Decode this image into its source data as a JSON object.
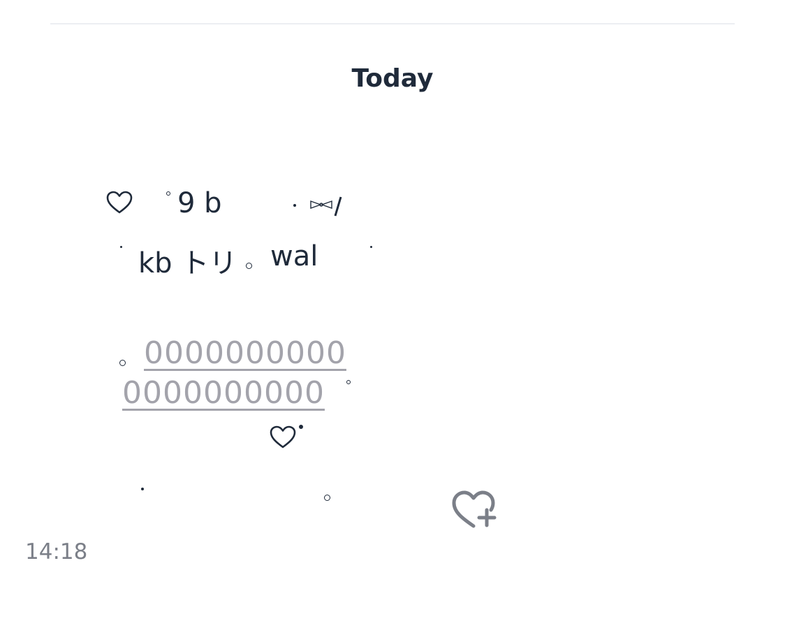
{
  "date_separator": "Today",
  "message": {
    "line1": {
      "text": "9 b",
      "heart_icon": "heart-outline-icon",
      "bow_icon": "bow-ribbon-icon"
    },
    "line2": {
      "part1": "kb トリ",
      "part2": "wal"
    },
    "link_line1": "0000000000",
    "link_line2": "0000000000",
    "heart_icon": "heart-outline-icon"
  },
  "reaction_button": {
    "icon": "heart-plus-icon"
  },
  "timestamp": "14:18",
  "colors": {
    "text": "#1f2a3a",
    "link": "#a3a3ab",
    "timestamp": "#7b7f88",
    "divider": "#eceef2",
    "icon_gray": "#7b7f88"
  }
}
